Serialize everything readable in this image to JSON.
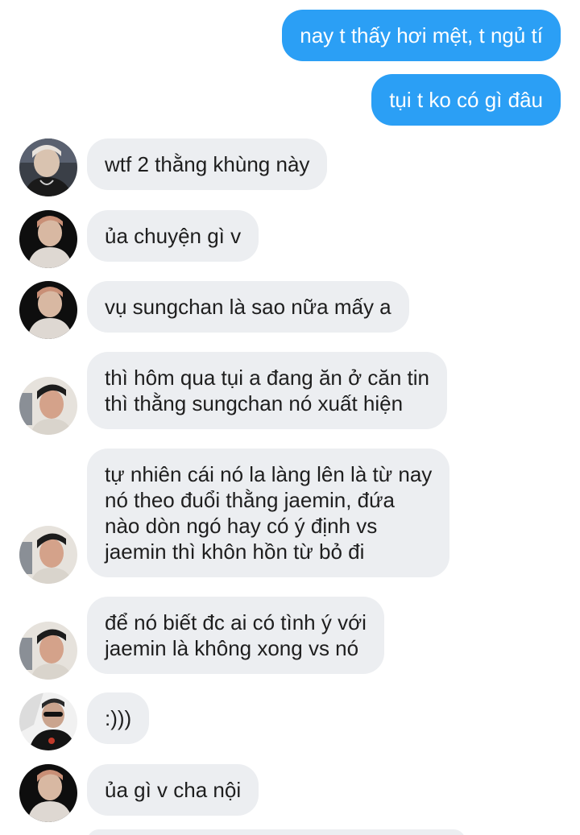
{
  "messages": [
    {
      "direction": "out",
      "text": "nay t thấy hơi mệt, t ngủ tí"
    },
    {
      "direction": "out",
      "text": "tụi t ko có gì đâu"
    },
    {
      "direction": "in",
      "sender_avatar": "avatar-a",
      "text": "wtf 2 thằng khùng này"
    },
    {
      "direction": "in",
      "sender_avatar": "avatar-b",
      "text": "ủa chuyện gì v"
    },
    {
      "direction": "in",
      "sender_avatar": "avatar-b",
      "text": "vụ sungchan là sao nữa mấy a"
    },
    {
      "direction": "in",
      "sender_avatar": "avatar-c",
      "text": "thì hôm qua tụi a đang ăn ở căn tin\nthì thằng sungchan nó xuất hiện"
    },
    {
      "direction": "in",
      "sender_avatar": "avatar-c",
      "text": "tự nhiên cái nó la làng lên là từ nay\nnó theo đuổi thằng jaemin, đứa\nnào dòn ngó hay có ý định vs\njaemin thì khôn hồn từ bỏ đi"
    },
    {
      "direction": "in",
      "sender_avatar": "avatar-c",
      "text": "để nó biết đc ai có tình ý với\njaemin là không xong vs nó"
    },
    {
      "direction": "in",
      "sender_avatar": "avatar-d",
      "text": ":)))"
    },
    {
      "direction": "in",
      "sender_avatar": "avatar-b",
      "text": "ủa gì v cha nội"
    }
  ],
  "colors": {
    "outgoing_bubble": "#2b9ff5",
    "incoming_bubble": "#eceef1",
    "outgoing_text": "#ffffff",
    "incoming_text": "#1e1e1e"
  }
}
